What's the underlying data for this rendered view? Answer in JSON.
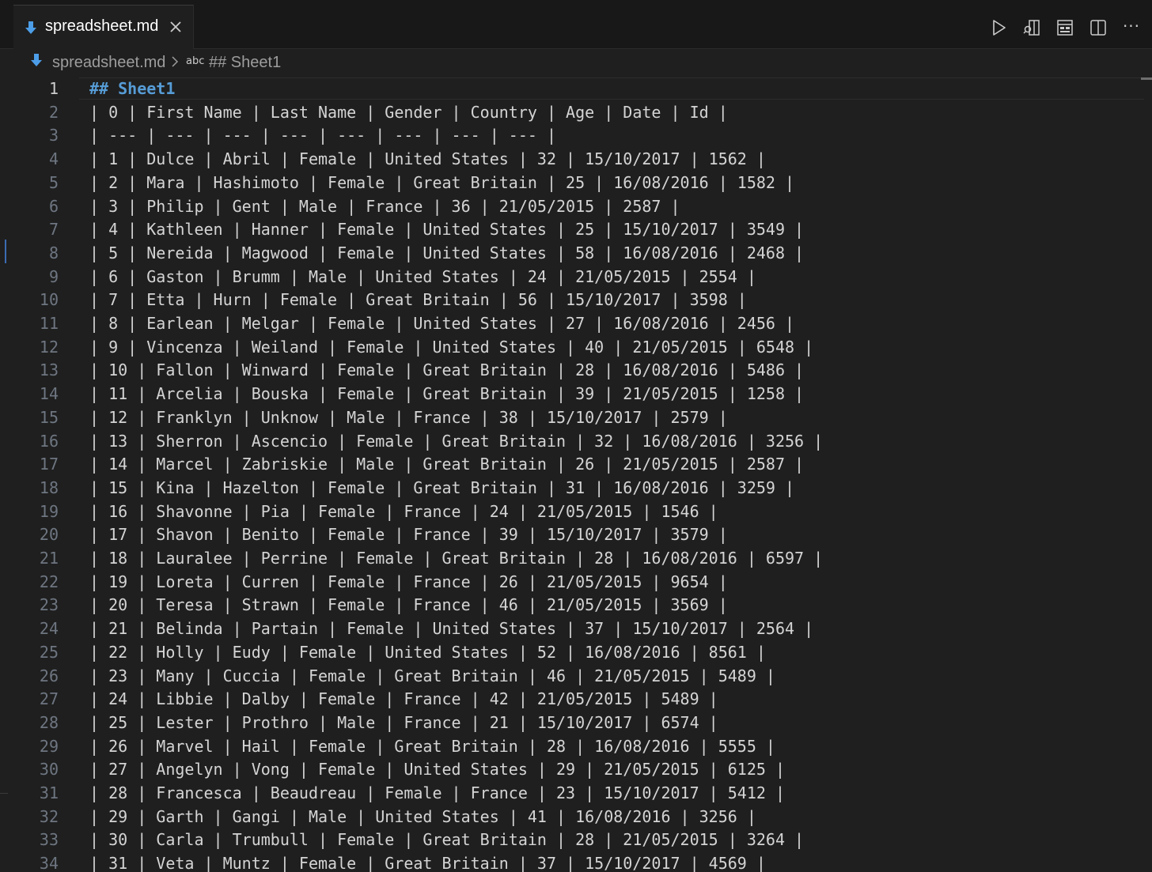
{
  "tab": {
    "label": "spreadsheet.md"
  },
  "breadcrumb": {
    "file": "spreadsheet.md",
    "symbol_kind": "abc",
    "symbol": "## Sheet1"
  },
  "actions": {
    "icons": [
      "run-icon",
      "open-preview-to-side-icon",
      "layout-icon",
      "split-editor-icon"
    ],
    "more": "···"
  },
  "colors": {
    "heading": "#569cd6",
    "text": "#d4d4d4",
    "line_number": "#6e7681",
    "background": "#1f1f1f"
  },
  "editor": {
    "lines": [
      "## Sheet1",
      "| 0 | First Name | Last Name | Gender | Country | Age | Date | Id |",
      "| --- | --- | --- | --- | --- | --- | --- | --- |",
      "| 1 | Dulce | Abril | Female | United States | 32 | 15/10/2017 | 1562 |",
      "| 2 | Mara | Hashimoto | Female | Great Britain | 25 | 16/08/2016 | 1582 |",
      "| 3 | Philip | Gent | Male | France | 36 | 21/05/2015 | 2587 |",
      "| 4 | Kathleen | Hanner | Female | United States | 25 | 15/10/2017 | 3549 |",
      "| 5 | Nereida | Magwood | Female | United States | 58 | 16/08/2016 | 2468 |",
      "| 6 | Gaston | Brumm | Male | United States | 24 | 21/05/2015 | 2554 |",
      "| 7 | Etta | Hurn | Female | Great Britain | 56 | 15/10/2017 | 3598 |",
      "| 8 | Earlean | Melgar | Female | United States | 27 | 16/08/2016 | 2456 |",
      "| 9 | Vincenza | Weiland | Female | United States | 40 | 21/05/2015 | 6548 |",
      "| 10 | Fallon | Winward | Female | Great Britain | 28 | 16/08/2016 | 5486 |",
      "| 11 | Arcelia | Bouska | Female | Great Britain | 39 | 21/05/2015 | 1258 |",
      "| 12 | Franklyn | Unknow | Male | France | 38 | 15/10/2017 | 2579 |",
      "| 13 | Sherron | Ascencio | Female | Great Britain | 32 | 16/08/2016 | 3256 |",
      "| 14 | Marcel | Zabriskie | Male | Great Britain | 26 | 21/05/2015 | 2587 |",
      "| 15 | Kina | Hazelton | Female | Great Britain | 31 | 16/08/2016 | 3259 |",
      "| 16 | Shavonne | Pia | Female | France | 24 | 21/05/2015 | 1546 |",
      "| 17 | Shavon | Benito | Female | France | 39 | 15/10/2017 | 3579 |",
      "| 18 | Lauralee | Perrine | Female | Great Britain | 28 | 16/08/2016 | 6597 |",
      "| 19 | Loreta | Curren | Female | France | 26 | 21/05/2015 | 9654 |",
      "| 20 | Teresa | Strawn | Female | France | 46 | 21/05/2015 | 3569 |",
      "| 21 | Belinda | Partain | Female | United States | 37 | 15/10/2017 | 2564 |",
      "| 22 | Holly | Eudy | Female | United States | 52 | 16/08/2016 | 8561 |",
      "| 23 | Many | Cuccia | Female | Great Britain | 46 | 21/05/2015 | 5489 |",
      "| 24 | Libbie | Dalby | Female | France | 42 | 21/05/2015 | 5489 |",
      "| 25 | Lester | Prothro | Male | France | 21 | 15/10/2017 | 6574 |",
      "| 26 | Marvel | Hail | Female | Great Britain | 28 | 16/08/2016 | 5555 |",
      "| 27 | Angelyn | Vong | Female | United States | 29 | 21/05/2015 | 6125 |",
      "| 28 | Francesca | Beaudreau | Female | France | 23 | 15/10/2017 | 5412 |",
      "| 29 | Garth | Gangi | Male | United States | 41 | 16/08/2016 | 3256 |",
      "| 30 | Carla | Trumbull | Female | Great Britain | 28 | 21/05/2015 | 3264 |",
      "| 31 | Veta | Muntz | Female | Great Britain | 37 | 15/10/2017 | 4569 |"
    ]
  }
}
